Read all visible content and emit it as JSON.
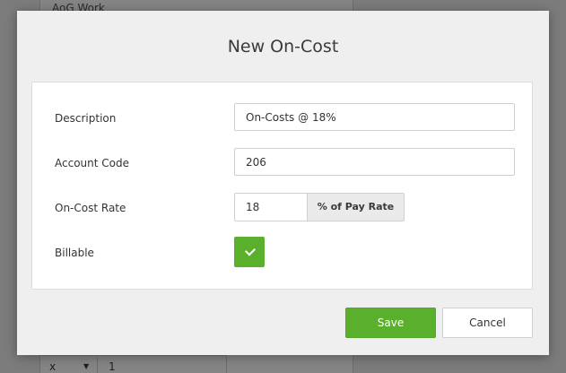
{
  "background": {
    "top_row_text": "AoG Work",
    "bottom_select_value": "x",
    "bottom_number": "1"
  },
  "modal": {
    "title": "New On-Cost",
    "fields": {
      "description": {
        "label": "Description",
        "value": "On-Costs @ 18%"
      },
      "account_code": {
        "label": "Account Code",
        "value": "206"
      },
      "on_cost_rate": {
        "label": "On-Cost Rate",
        "value": "18",
        "unit": "% of Pay Rate"
      },
      "billable": {
        "label": "Billable",
        "checked": true
      }
    },
    "buttons": {
      "save_label": "Save",
      "cancel_label": "Cancel"
    }
  },
  "colors": {
    "accent_green": "#5aaf2c",
    "overlay": "#7c7c7c"
  },
  "icons": {
    "billable_toggle": "check-icon",
    "select_caret": "caret-down-icon"
  }
}
